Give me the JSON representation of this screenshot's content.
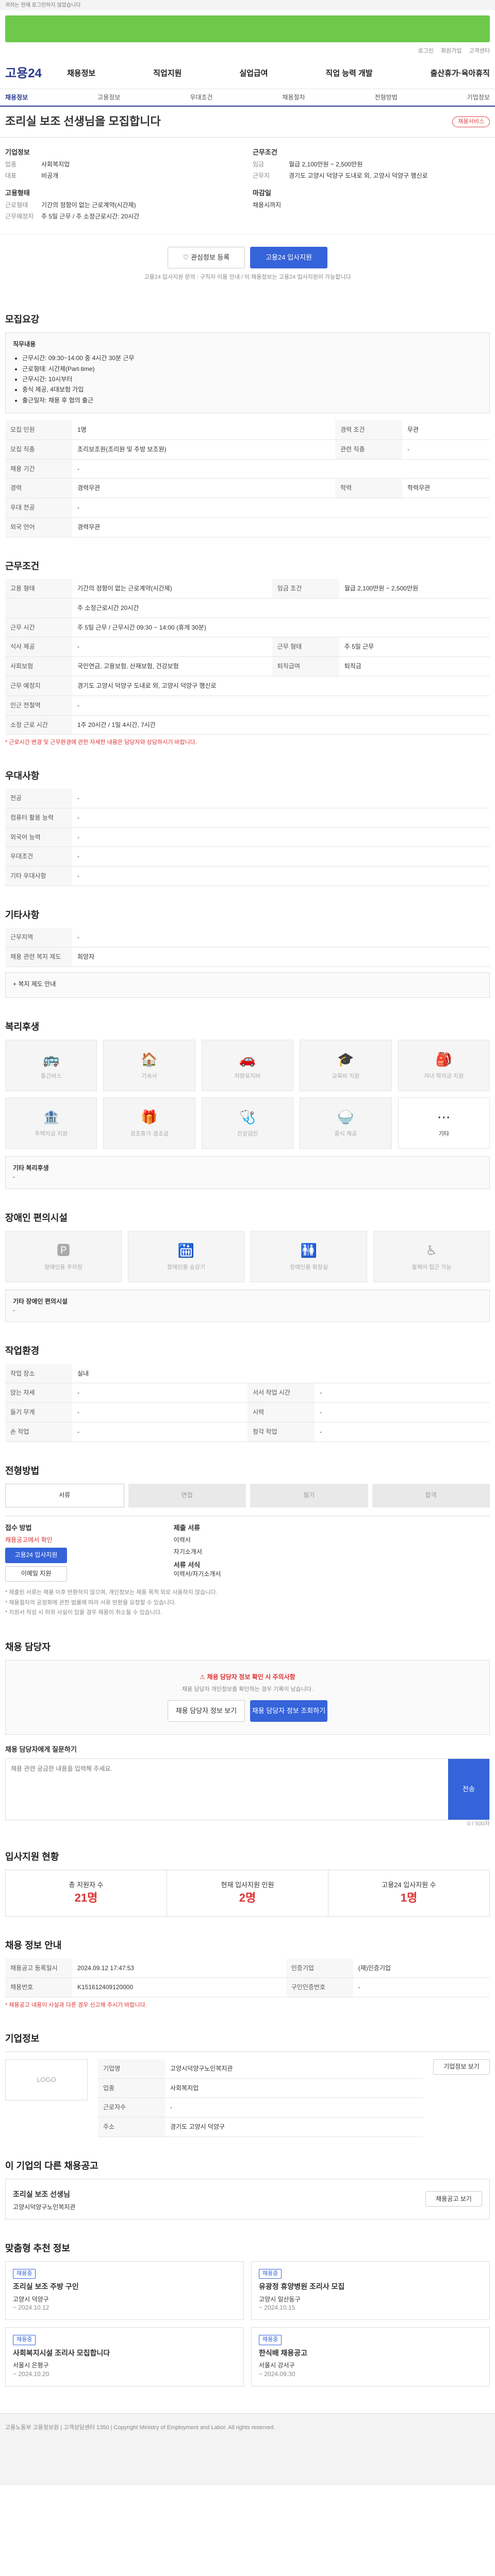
{
  "header": {
    "top_notice": "귀하는 현재 로그인하지 않았습니다",
    "util": [
      "로그인",
      "회원가입",
      "고객센터"
    ],
    "logo": "고용24",
    "menu": [
      "채용정보",
      "직업지원",
      "실업급여",
      "직업 능력 개발",
      "출산휴가·육아휴직"
    ],
    "subnav": [
      "채용정보",
      "고용정보",
      "우대조건",
      "채용절차",
      "전형방법",
      "기업정보"
    ]
  },
  "job": {
    "title": "조리실 보조 선생님을 모집합니다",
    "badge": "채용서비스",
    "company_label": "기업정보",
    "company_rows": [
      [
        "업종",
        "사회복지업"
      ],
      [
        "대표",
        "비공개"
      ]
    ],
    "cond_label": "근무조건",
    "cond_rows": [
      [
        "임금",
        "월급 2,100만원 ~ 2,500만원"
      ],
      [
        "근무지",
        "경기도 고양시 덕양구 도내로 외, 고양시 덕양구 행신로"
      ]
    ],
    "worktype_label": "고용형태",
    "worktype_rows": [
      [
        "근로형태",
        "기간의 정함이 없는 근로계약(시간제)"
      ],
      [
        "근무예정지",
        "주 5일 근무 / 주 소정근로시간: 20시간"
      ]
    ],
    "closing_label": "마감일",
    "closing_value": "채용시까지",
    "btn_interest": "관심정보 등록",
    "btn_apply": "고용24 입사지원",
    "apply_note": "고용24 입사지원 문의 : 구직자 이용 안내 / 이 채용정보는 고용24 입사지원이 가능합니다"
  },
  "recruit": {
    "heading": "모집요강",
    "duty_label": "직무내용",
    "duties": [
      "근무시간: 09:30~14:00 중 4시간 30분 근무",
      "근로형태: 시간제(Part-time)",
      "근무시간: 10시부터",
      "중식 제공, 4대보험 가입",
      "출근일자: 채용 후 협의 출근"
    ],
    "rows": [
      [
        "모집 인원",
        "1명",
        "경력 조건",
        "무관"
      ],
      [
        "모집 직종",
        "조리보조원(조리원 및 주방 보조원)",
        "관련 직종",
        "-"
      ],
      [
        "채용 기간",
        "-",
        "",
        ""
      ],
      [
        "경력",
        "경력무관",
        "학력",
        "학력무관"
      ],
      [
        "우대 전공",
        "-",
        "",
        ""
      ],
      [
        "외국 언어",
        "경력무관",
        "",
        ""
      ]
    ]
  },
  "work": {
    "heading": "근무조건",
    "rows": [
      [
        "고용 형태",
        "기간의 정함이 없는 근로계약(시간제)",
        "임금 조건",
        "월급 2,100만원 ~ 2,500만원"
      ],
      [
        "",
        "주 소정근로시간 20시간",
        "",
        ""
      ],
      [
        "근무 시간",
        "주 5일 근무 / 근무시간 09:30 ~ 14:00 (휴게 30분)",
        "",
        ""
      ],
      [
        "식사 제공",
        "-",
        "근무 형태",
        "주 5일 근무"
      ],
      [
        "사회보험",
        "국민연금, 고용보험, 산재보험, 건강보험",
        "퇴직급여",
        "퇴직금"
      ],
      [
        "근무 예정지",
        "경기도 고양시 덕양구 도내로 외, 고양시 덕양구 행신로",
        "",
        ""
      ],
      [
        "인근 전철역",
        "-",
        "",
        ""
      ],
      [
        "소정 근로 시간",
        "1주 20시간 / 1일 4시간, 7시간",
        "",
        ""
      ]
    ],
    "note": "* 근로시간 변경 및 근무환경에 관한 자세한 내용은 담당자와 상담하시기 바랍니다."
  },
  "prefer": {
    "heading": "우대사항",
    "rows": [
      [
        "전공",
        "-"
      ],
      [
        "컴퓨터 활용 능력",
        "-"
      ],
      [
        "외국어 능력",
        "-"
      ],
      [
        "우대조건",
        "-"
      ],
      [
        "기타 우대사항",
        "-"
      ]
    ]
  },
  "other": {
    "heading": "기타사항",
    "rows": [
      [
        "근무지역",
        "-"
      ],
      [
        "채용 관련 복지 제도",
        "희망자"
      ]
    ],
    "more": "+ 복지 제도 안내"
  },
  "welfare": {
    "heading": "복리후생",
    "items": [
      "통근버스",
      "기숙사",
      "차량유지비",
      "교육비 지원",
      "자녀 학자금 지원",
      "주택자금 지원",
      "경조휴가·경조금",
      "건강검진",
      "중식 제공",
      "기타"
    ],
    "other_label": "기타 복리후생",
    "other_value": "-"
  },
  "disabled": {
    "heading": "장애인 편의시설",
    "items": [
      "장애인용 주차장",
      "장애인용 승강기",
      "장애인용 화장실",
      "휠체어 접근 가능"
    ],
    "label": "기타 장애인 편의시설",
    "value": "-"
  },
  "env": {
    "heading": "작업환경",
    "rows": [
      [
        "작업 장소",
        "실내",
        "",
        ""
      ],
      [
        "앉는 자세",
        "-",
        "서서 작업 시간",
        "-"
      ],
      [
        "들기 무게",
        "-",
        "시력",
        "-"
      ],
      [
        "손 작업",
        "-",
        "청각 작업",
        "-"
      ]
    ]
  },
  "process": {
    "heading": "전형방법",
    "steps": [
      "서류",
      "면접",
      "필기",
      "합격"
    ],
    "method_label": "접수 방법",
    "method_values": [
      "채용공고에서 확인",
      "고용24 입사지원"
    ],
    "method_btn": "고용24 입사지원",
    "mail_btn": "이메일 지원",
    "docs_label": "제출 서류",
    "docs_values": [
      "이력서",
      "자기소개서"
    ],
    "docs_sub": "제출서류 보기",
    "form_label": "서류 서식",
    "form_value": "이력서/자기소개서",
    "notes": [
      "* 제출된 서류는 채용 이후 반환하지 않으며, 개인정보는 채용 목적 외로 사용하지 않습니다.",
      "* 채용절차의 공정화에 관한 법률에 따라 서류 반환을 요청할 수 있습니다.",
      "* 지원서 작성 시 허위 사실이 있을 경우 채용이 취소될 수 있습니다."
    ]
  },
  "contact": {
    "heading": "채용 담당자",
    "alert": "채용 담당자 정보 확인 시 주의사항",
    "alert_desc": "채용 담당자 개인정보를 확인하는 경우 기록이 남습니다.",
    "btn_check": "채용 담당자 정보 보기",
    "btn_report": "채용 담당자 정보 조회하기",
    "inquiry_label": "채용 담당자에게 질문하기",
    "inquiry_placeholder": "채용 관련 궁금한 내용을 입력해 주세요.",
    "send": "전송",
    "char": "0 / 500자"
  },
  "stats": {
    "heading": "입사지원 현황",
    "items": [
      [
        "총 지원자 수",
        "21명"
      ],
      [
        "현재 입사지원 인원",
        "2명"
      ],
      [
        "고용24 입사지원 수",
        "1명"
      ]
    ]
  },
  "info": {
    "heading": "채용 정보 안내",
    "rows": [
      [
        "채용공고 등록일시",
        "2024.09.12 17:47:53",
        "인증기업",
        "(재)인증기업"
      ],
      [
        "채용번호",
        "K151612409120000",
        "구인인증번호",
        "-"
      ]
    ],
    "warn": "* 채용공고 내용이 사실과 다른 경우 신고해 주시기 바랍니다."
  },
  "company": {
    "heading": "기업정보",
    "logo": "LOGO",
    "rows": [
      [
        "기업명",
        "고양시덕양구노인복지관"
      ],
      [
        "업종",
        "사회복지업"
      ],
      [
        "근로자수",
        "-"
      ],
      [
        "주소",
        "경기도 고양시 덕양구"
      ]
    ],
    "btn": "기업정보 보기"
  },
  "similar": {
    "heading": "이 기업의 다른 채용공고",
    "title": "조리실 보조 선생님",
    "sub": "고양시덕양구노인복지관",
    "btn": "채용공고 보기"
  },
  "recommend": {
    "heading": "맞춤형 추천 정보",
    "cards": [
      {
        "tag": "채용중",
        "t": "조리실 보조 주방 구인",
        "c": "고양시 덕양구",
        "d": "~ 2024.10.12"
      },
      {
        "tag": "채용중",
        "t": "유광정 휴양병원 조리사 모집",
        "c": "고양시 일산동구",
        "d": "~ 2024.10.15"
      },
      {
        "tag": "채용중",
        "t": "사회복지시설 조리사 모집합니다",
        "c": "서울시 은평구",
        "d": "~ 2024.10.20"
      },
      {
        "tag": "채용중",
        "t": "한식배 채용공고",
        "c": "서울시 강서구",
        "d": "~ 2024.09.30"
      }
    ]
  },
  "footer": {
    "text": "고용노동부 고용정보원 | 고객상담센터 1350 | Copyright Ministry of Employment and Labor. All rights reserved."
  }
}
